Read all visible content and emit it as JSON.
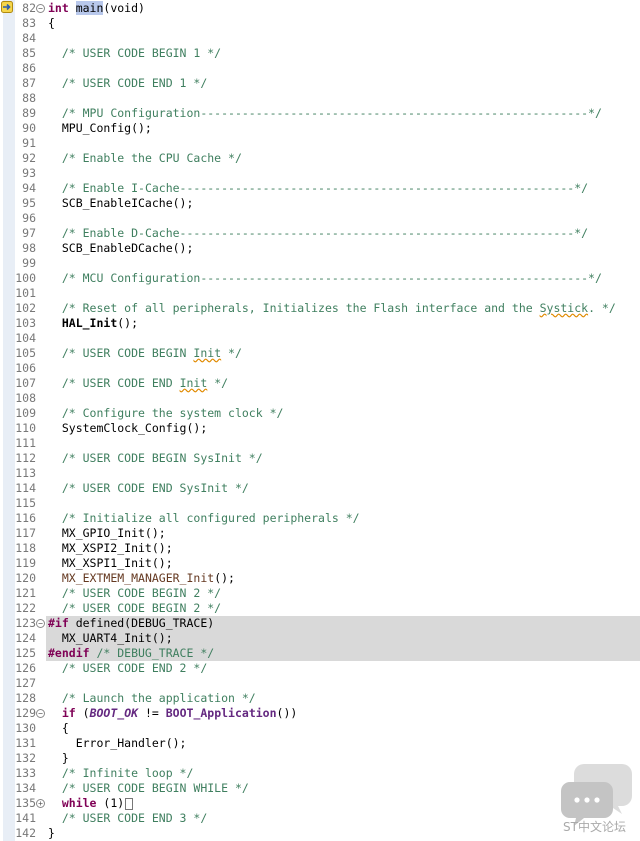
{
  "editor": {
    "lines": [
      {
        "n": "82",
        "segs": [
          [
            "k",
            "int "
          ],
          [
            "sel",
            "main"
          ],
          [
            "",
            "(void)"
          ]
        ],
        "fold": "minus",
        "marker": true
      },
      {
        "n": "83",
        "segs": [
          [
            "",
            "{"
          ]
        ]
      },
      {
        "n": "84",
        "segs": []
      },
      {
        "n": "85",
        "segs": [
          [
            "",
            "  "
          ],
          [
            "c",
            "/* USER CODE BEGIN 1 */"
          ]
        ]
      },
      {
        "n": "86",
        "segs": []
      },
      {
        "n": "87",
        "segs": [
          [
            "",
            "  "
          ],
          [
            "c",
            "/* USER CODE END 1 */"
          ]
        ]
      },
      {
        "n": "88",
        "segs": []
      },
      {
        "n": "89",
        "segs": [
          [
            "",
            "  "
          ],
          [
            "c",
            "/* MPU Configuration--------------------------------------------------------*/"
          ]
        ]
      },
      {
        "n": "90",
        "segs": [
          [
            "",
            "  MPU_Config();"
          ]
        ]
      },
      {
        "n": "91",
        "segs": []
      },
      {
        "n": "92",
        "segs": [
          [
            "",
            "  "
          ],
          [
            "c",
            "/* Enable the CPU Cache */"
          ]
        ]
      },
      {
        "n": "93",
        "segs": []
      },
      {
        "n": "94",
        "segs": [
          [
            "",
            "  "
          ],
          [
            "c",
            "/* Enable I-Cache---------------------------------------------------------*/"
          ]
        ]
      },
      {
        "n": "95",
        "segs": [
          [
            "",
            "  SCB_EnableICache();"
          ]
        ]
      },
      {
        "n": "96",
        "segs": []
      },
      {
        "n": "97",
        "segs": [
          [
            "",
            "  "
          ],
          [
            "c",
            "/* Enable D-Cache---------------------------------------------------------*/"
          ]
        ]
      },
      {
        "n": "98",
        "segs": [
          [
            "",
            "  SCB_EnableDCache();"
          ]
        ]
      },
      {
        "n": "99",
        "segs": []
      },
      {
        "n": "100",
        "segs": [
          [
            "",
            "  "
          ],
          [
            "c",
            "/* MCU Configuration--------------------------------------------------------*/"
          ]
        ]
      },
      {
        "n": "101",
        "segs": []
      },
      {
        "n": "102",
        "segs": [
          [
            "",
            "  "
          ],
          [
            "c",
            "/* Reset of all peripherals, Initializes the Flash interface and the "
          ],
          [
            "c wavy",
            "Systick"
          ],
          [
            "c",
            ". */"
          ]
        ]
      },
      {
        "n": "103",
        "segs": [
          [
            "",
            "  "
          ],
          [
            "fn",
            "HAL_Init"
          ],
          [
            "",
            "();"
          ]
        ]
      },
      {
        "n": "104",
        "segs": []
      },
      {
        "n": "105",
        "segs": [
          [
            "",
            "  "
          ],
          [
            "c",
            "/* USER CODE BEGIN "
          ],
          [
            "c wavy",
            "Init"
          ],
          [
            "c",
            " */"
          ]
        ]
      },
      {
        "n": "106",
        "segs": []
      },
      {
        "n": "107",
        "segs": [
          [
            "",
            "  "
          ],
          [
            "c",
            "/* USER CODE END "
          ],
          [
            "c wavy",
            "Init"
          ],
          [
            "c",
            " */"
          ]
        ]
      },
      {
        "n": "108",
        "segs": []
      },
      {
        "n": "109",
        "segs": [
          [
            "",
            "  "
          ],
          [
            "c",
            "/* Configure the system clock */"
          ]
        ]
      },
      {
        "n": "110",
        "segs": [
          [
            "",
            "  SystemClock_Config();"
          ]
        ]
      },
      {
        "n": "111",
        "segs": []
      },
      {
        "n": "112",
        "segs": [
          [
            "",
            "  "
          ],
          [
            "c",
            "/* USER CODE BEGIN SysInit */"
          ]
        ]
      },
      {
        "n": "113",
        "segs": []
      },
      {
        "n": "114",
        "segs": [
          [
            "",
            "  "
          ],
          [
            "c",
            "/* USER CODE END SysInit */"
          ]
        ]
      },
      {
        "n": "115",
        "segs": []
      },
      {
        "n": "116",
        "segs": [
          [
            "",
            "  "
          ],
          [
            "c",
            "/* Initialize all configured peripherals */"
          ]
        ]
      },
      {
        "n": "117",
        "segs": [
          [
            "",
            "  MX_GPIO_Init();"
          ]
        ]
      },
      {
        "n": "118",
        "segs": [
          [
            "",
            "  MX_XSPI2_Init();"
          ]
        ]
      },
      {
        "n": "119",
        "segs": [
          [
            "",
            "  MX_XSPI1_Init();"
          ]
        ]
      },
      {
        "n": "120",
        "segs": [
          [
            "",
            "  "
          ],
          [
            "p",
            "MX_EXTMEM_MANAGER_Init"
          ],
          [
            "",
            "();"
          ]
        ]
      },
      {
        "n": "121",
        "segs": [
          [
            "",
            "  "
          ],
          [
            "c",
            "/* USER CODE BEGIN 2 */"
          ]
        ]
      },
      {
        "n": "122",
        "segs": [
          [
            "",
            "  "
          ],
          [
            "c",
            "/* USER CODE BEGIN 2 */"
          ]
        ]
      },
      {
        "n": "123",
        "segs": [
          [
            "k",
            "#if "
          ],
          [
            "",
            "defined(DEBUG_TRACE)"
          ]
        ],
        "fold": "minus",
        "hl": true
      },
      {
        "n": "124",
        "segs": [
          [
            "",
            "  MX_UART4_Init();"
          ]
        ],
        "hl": true
      },
      {
        "n": "125",
        "segs": [
          [
            "k",
            "#endif "
          ],
          [
            "c",
            "/* DEBUG_TRACE */"
          ]
        ],
        "hl": true
      },
      {
        "n": "126",
        "segs": [
          [
            "",
            "  "
          ],
          [
            "c",
            "/* USER CODE END 2 */"
          ]
        ]
      },
      {
        "n": "127",
        "segs": []
      },
      {
        "n": "128",
        "segs": [
          [
            "",
            "  "
          ],
          [
            "c",
            "/* Launch the application */"
          ]
        ]
      },
      {
        "n": "129",
        "segs": [
          [
            "",
            "  "
          ],
          [
            "k",
            "if"
          ],
          [
            "",
            " ("
          ],
          [
            "mi",
            "BOOT_OK"
          ],
          [
            "",
            " != "
          ],
          [
            "m",
            "BOOT_Application"
          ],
          [
            "",
            "())"
          ]
        ],
        "fold": "minus"
      },
      {
        "n": "130",
        "segs": [
          [
            "",
            "  {"
          ]
        ]
      },
      {
        "n": "131",
        "segs": [
          [
            "",
            "    Error_Handler();"
          ]
        ]
      },
      {
        "n": "132",
        "segs": [
          [
            "",
            "  }"
          ]
        ]
      },
      {
        "n": "133",
        "segs": [
          [
            "",
            "  "
          ],
          [
            "c",
            "/* Infinite loop */"
          ]
        ]
      },
      {
        "n": "134",
        "segs": [
          [
            "",
            "  "
          ],
          [
            "c",
            "/* USER CODE BEGIN WHILE */"
          ]
        ]
      },
      {
        "n": "135",
        "segs": [
          [
            "",
            "  "
          ],
          [
            "k",
            "while"
          ],
          [
            "",
            " (1)"
          ]
        ],
        "fold": "plus",
        "collapsed": true
      },
      {
        "n": "141",
        "segs": [
          [
            "",
            "  "
          ],
          [
            "c",
            "/* USER CODE END 3 */"
          ]
        ]
      },
      {
        "n": "142",
        "segs": [
          [
            "",
            "}"
          ]
        ]
      }
    ]
  },
  "watermark": {
    "text": "ST中文论坛",
    "color": "#c8c8c8"
  },
  "colors": {
    "comment": "#3f7f5f",
    "keyword": "#7f0055",
    "highlight": "#d9d9d9",
    "selection": "#b8c8ec"
  }
}
